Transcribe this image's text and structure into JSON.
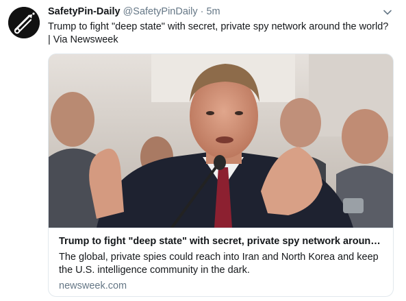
{
  "tweet": {
    "display_name": "SafetyPin-Daily",
    "handle": "@SafetyPinDaily",
    "separator": "·",
    "time": "5m",
    "text": "Trump to fight \"deep state\" with secret, private spy network around the world? | Via Newsweek",
    "avatar_icon": "safety-pin-logo-icon",
    "menu_icon": "chevron-down-icon"
  },
  "card": {
    "title": "Trump to fight \"deep state\" with secret, private spy network around t...",
    "description": "The global, private spies could reach into Iran and North Korea and keep the U.S. intelligence community in the dark.",
    "domain": "newsweek.com",
    "image_subject": "man-testifying-at-hearing-photo"
  },
  "colors": {
    "text_primary": "#14171a",
    "text_secondary": "#657786",
    "border": "#e1e8ed",
    "avatar_bg": "#111111"
  }
}
